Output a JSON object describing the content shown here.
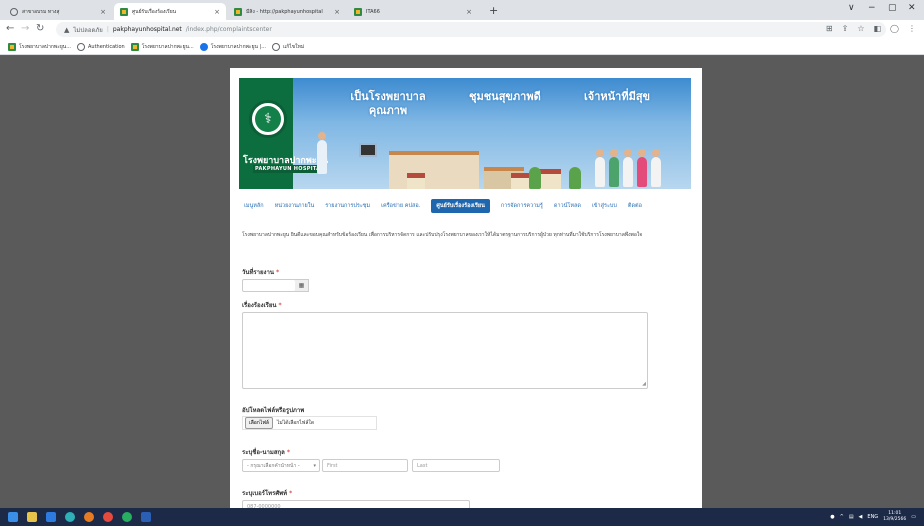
{
  "browser": {
    "tabs": [
      {
        "title": "สาขาอบรม ทางสุ",
        "icon": "globe-icon",
        "active": false
      },
      {
        "title": "ศูนย์รับเรื่องร้องเรียน",
        "icon": "hospital-logo-icon",
        "active": true
      },
      {
        "title": "มีสิง - http://pakphayunhospital",
        "icon": "hospital-logo-icon",
        "active": false
      },
      {
        "title": "ITA66",
        "icon": "hospital-logo-icon",
        "active": false
      }
    ],
    "new_tab": "+",
    "window_controls": [
      "∨",
      "−",
      "▢",
      "✕"
    ],
    "address": {
      "security": "ไม่ปลอดภัย",
      "host": "pakphayunhospital.net",
      "path": "/index.php/complaintscenter"
    },
    "bookmarks": [
      {
        "label": "โรงพยาบาลปากพะยูน...",
        "icon": "hospital-logo-icon"
      },
      {
        "label": "Authentication",
        "icon": "globe-icon"
      },
      {
        "label": "โรงพยาบาลปากพะยูน...",
        "icon": "hospital-logo-icon"
      },
      {
        "label": "โรงพยาบาลปากพะยูน |...",
        "icon": "blue-globe-icon"
      },
      {
        "label": "แก้ไขใหม่",
        "icon": "globe-icon"
      }
    ]
  },
  "banner": {
    "hospital_name_1": "โรงพยาบาล",
    "hospital_name_2": "ปากพะยูน",
    "hospital_en": "PAKPHAYUN HOSPITAL",
    "slogans": [
      "เป็นโรงพยาบาลคุณภาพ",
      "ชุมชนสุขภาพดี",
      "เจ้าหน้าที่มีสุข"
    ]
  },
  "menu": [
    {
      "label": "เมนูหลัก",
      "active": false
    },
    {
      "label": "หน่วยงานภายใน",
      "active": false
    },
    {
      "label": "รายงานการประชุม",
      "active": false
    },
    {
      "label": "เครือข่าย คปสอ.",
      "active": false
    },
    {
      "label": "ศูนย์รับเรื่องร้องเรียน",
      "active": true
    },
    {
      "label": "การจัดการความรู้",
      "active": false
    },
    {
      "label": "ดาวน์โหลด",
      "active": false
    },
    {
      "label": "เข้าสู่ระบบ",
      "active": false
    },
    {
      "label": "ติดต่อ",
      "active": false
    }
  ],
  "intro": "โรงพยาบาลปากพะยูน ยินดีและขอบคุณสำหรับข้อร้องเรียน เพื่อการบริหารจัดการ และปรับปรุงโรงพยาบาลของเราให้ได้มาตรฐานการบริการผู้ป่วย ทุกท่านที่มาใช้บริการโรงพยาบาลพึงพอใจ",
  "form": {
    "date_label": "วันที่รายงาน",
    "complaint_label": "เรื่องร้องเรียน",
    "upload_label": "อัปโหลดไฟล์หรือรูปภาพ",
    "file_button": "เลือกไฟล์",
    "file_status": "ไม่ได้เลือกไฟล์ใด",
    "name_label": "ระบุชื่อ-นามสกุล",
    "prefix_placeholder": "- กรุณาเลือกคำนำหน้า -",
    "first_placeholder": "First",
    "last_placeholder": "Last",
    "phone_label": "ระบุเบอร์โทรศัพท์",
    "phone_placeholder": "087-0000000",
    "required_mark": "*"
  },
  "taskbar": {
    "lang": "ENG",
    "time": "11:01",
    "date": "13/9/2566"
  },
  "colors": {
    "accent": "#1e66ad",
    "link": "#2a6fb3",
    "required": "#d9534f",
    "hospital_green": "#0c6e3f"
  }
}
